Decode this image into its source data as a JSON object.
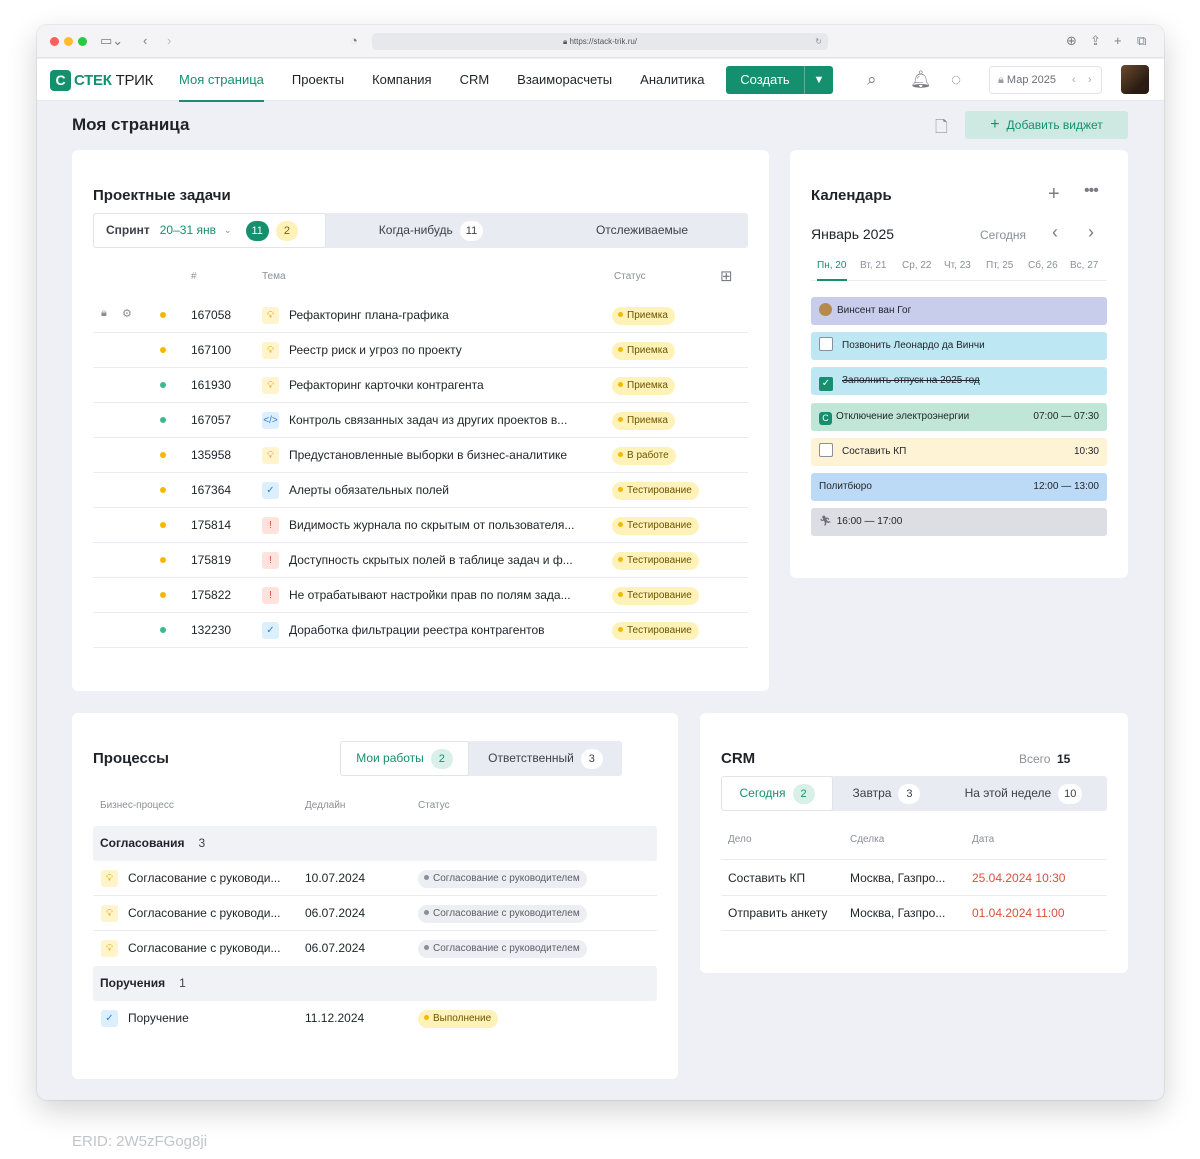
{
  "browser": {
    "url": "https://stack-trik.ru/"
  },
  "header": {
    "logo_part1": "СТЕК",
    "logo_part2": "ТРИК",
    "logo_mark": "С",
    "nav": [
      "Моя страница",
      "Проекты",
      "Компания",
      "CRM",
      "Взаиморасчеты",
      "Аналитика"
    ],
    "create_label": "Создать",
    "period": "Мар 2025"
  },
  "page": {
    "title": "Моя страница",
    "add_widget": "Добавить виджет"
  },
  "tasks": {
    "title": "Проектные задачи",
    "tabs": {
      "sprint_label": "Спринт",
      "sprint_range": "20–31 янв",
      "sprint_count_a": "11",
      "sprint_count_b": "2",
      "someday_label": "Когда-нибудь",
      "someday_count": "11",
      "tracked_label": "Отслеживаемые"
    },
    "columns": {
      "num": "#",
      "topic": "Тема",
      "status": "Статус"
    },
    "rows": [
      {
        "id": "167058",
        "title": "Рефакторинг плана-графика",
        "status": "Приемка",
        "dot": "#f5b800",
        "icon": "idea",
        "locks": true
      },
      {
        "id": "167100",
        "title": "Реестр риск и угроз по проекту",
        "status": "Приемка",
        "dot": "#f5b800",
        "icon": "idea"
      },
      {
        "id": "161930",
        "title": "Рефакторинг карточки контрагента",
        "status": "Приемка",
        "dot": "#3bb98a",
        "icon": "idea"
      },
      {
        "id": "167057",
        "title": "Контроль связанных задач из других проектов в...",
        "status": "Приемка",
        "dot": "#3bb98a",
        "icon": "code"
      },
      {
        "id": "135958",
        "title": "Предустановленные выборки в бизнес-аналитике",
        "status": "В работе",
        "dot": "#f5b800",
        "icon": "idea"
      },
      {
        "id": "167364",
        "title": "Алерты обязательных полей",
        "status": "Тестирование",
        "dot": "#f5b800",
        "icon": "task"
      },
      {
        "id": "175814",
        "title": "Видимость журнала по скрытым от пользователя...",
        "status": "Тестирование",
        "dot": "#f5b800",
        "icon": "bug"
      },
      {
        "id": "175819",
        "title": "Доступность скрытых полей в таблице задач и ф...",
        "status": "Тестирование",
        "dot": "#f5b800",
        "icon": "bug"
      },
      {
        "id": "175822",
        "title": "Не отрабатывают настройки прав по полям зада...",
        "status": "Тестирование",
        "dot": "#f5b800",
        "icon": "bug"
      },
      {
        "id": "132230",
        "title": "Доработка фильтрации реестра контрагентов",
        "status": "Тестирование",
        "dot": "#3bb98a",
        "icon": "task"
      }
    ]
  },
  "calendar": {
    "title": "Календарь",
    "month": "Январь 2025",
    "today": "Сегодня",
    "days": [
      "Пн, 20",
      "Вт, 21",
      "Ср, 22",
      "Чт, 23",
      "Пт, 25",
      "Сб, 26",
      "Вс, 27"
    ],
    "events": [
      {
        "text": "Винсент ван Гог",
        "time": "",
        "bg": "#c9cdec",
        "kind": "person"
      },
      {
        "text": "Позвонить Леонардо да Винчи",
        "time": "",
        "bg": "#bde8f3",
        "kind": "check"
      },
      {
        "text": "Заполнить отпуск на 2025 год",
        "time": "",
        "bg": "#bde8f3",
        "kind": "checked"
      },
      {
        "text": "Отключение электроэнергии",
        "time": "07:00 — 07:30",
        "bg": "#bfe6d6",
        "kind": "brand"
      },
      {
        "text": "Составить КП",
        "time": "10:30",
        "bg": "#fff3d6",
        "kind": "check"
      },
      {
        "text": "Политбюро",
        "time": "12:00 — 13:00",
        "bg": "#bcd9f5",
        "kind": "plain"
      },
      {
        "text": "16:00 — 17:00",
        "time": "",
        "bg": "#dcdee3",
        "kind": "run"
      }
    ]
  },
  "processes": {
    "title": "Процессы",
    "tabs": {
      "mine": "Мои работы",
      "mine_count": "2",
      "resp": "Ответственный",
      "resp_count": "3"
    },
    "columns": {
      "bp": "Бизнес-процесс",
      "deadline": "Дедлайн",
      "status": "Статус"
    },
    "groups": [
      {
        "name": "Согласования",
        "count": "3",
        "rows": [
          {
            "name": "Согласование с руководи...",
            "date": "10.07.2024",
            "status": "Согласование с руководителем",
            "icon": "idea"
          },
          {
            "name": "Согласование с руководи...",
            "date": "06.07.2024",
            "status": "Согласование с руководителем",
            "icon": "idea"
          },
          {
            "name": "Согласование с руководи...",
            "date": "06.07.2024",
            "status": "Согласование с руководителем",
            "icon": "idea"
          }
        ]
      },
      {
        "name": "Поручения",
        "count": "1",
        "rows": [
          {
            "name": "Поручение",
            "date": "11.12.2024",
            "status": "Выполнение",
            "icon": "task"
          }
        ]
      }
    ]
  },
  "crm": {
    "title": "CRM",
    "total_label": "Всего",
    "total": "15",
    "tabs": {
      "today": "Сегодня",
      "today_count": "2",
      "tomorrow": "Завтра",
      "tomorrow_count": "3",
      "week": "На этой неделе",
      "week_count": "10"
    },
    "columns": {
      "deal": "Дело",
      "sale": "Сделка",
      "date": "Дата"
    },
    "rows": [
      {
        "deal": "Составить КП",
        "sale": "Москва, Газпро...",
        "date": "25.04.2024 10:30"
      },
      {
        "deal": "Отправить анкету",
        "sale": "Москва, Газпро...",
        "date": "01.04.2024 11:00"
      }
    ]
  },
  "footer": {
    "erid": "ERID: 2W5zFGog8ji"
  },
  "colors": {
    "brand": "#14906e",
    "overdue": "#d9503f"
  }
}
